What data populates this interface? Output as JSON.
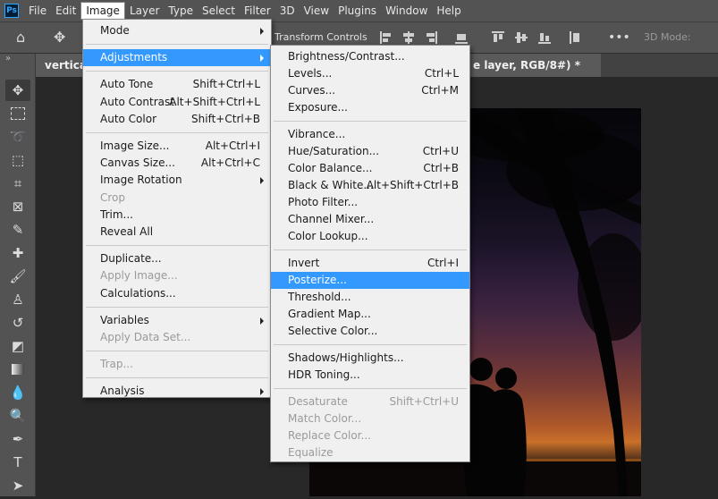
{
  "menubar": {
    "logo": "Ps",
    "items": [
      "File",
      "Edit",
      "Image",
      "Layer",
      "Type",
      "Select",
      "Filter",
      "3D",
      "View",
      "Plugins",
      "Window",
      "Help"
    ]
  },
  "options_bar": {
    "transform_controls": "Transform Controls",
    "mode_3d": "3D Mode:"
  },
  "tabs": {
    "doc1": "vertical",
    "doc2": "e layer, RGB/8#) *"
  },
  "image_menu": [
    {
      "label": "Mode",
      "arrow": true
    },
    {
      "sep": true
    },
    {
      "label": "Adjustments",
      "arrow": true,
      "highlighted": true
    },
    {
      "sep": true
    },
    {
      "label": "Auto Tone",
      "shortcut": "Shift+Ctrl+L"
    },
    {
      "label": "Auto Contrast",
      "shortcut": "Alt+Shift+Ctrl+L"
    },
    {
      "label": "Auto Color",
      "shortcut": "Shift+Ctrl+B"
    },
    {
      "sep": true
    },
    {
      "label": "Image Size...",
      "shortcut": "Alt+Ctrl+I"
    },
    {
      "label": "Canvas Size...",
      "shortcut": "Alt+Ctrl+C"
    },
    {
      "label": "Image Rotation",
      "arrow": true
    },
    {
      "label": "Crop",
      "disabled": true
    },
    {
      "label": "Trim..."
    },
    {
      "label": "Reveal All"
    },
    {
      "sep": true
    },
    {
      "label": "Duplicate..."
    },
    {
      "label": "Apply Image...",
      "disabled": true
    },
    {
      "label": "Calculations..."
    },
    {
      "sep": true
    },
    {
      "label": "Variables",
      "arrow": true
    },
    {
      "label": "Apply Data Set...",
      "disabled": true
    },
    {
      "sep": true
    },
    {
      "label": "Trap...",
      "disabled": true
    },
    {
      "sep": true
    },
    {
      "label": "Analysis",
      "arrow": true
    }
  ],
  "adjustments_menu": [
    {
      "label": "Brightness/Contrast..."
    },
    {
      "label": "Levels...",
      "shortcut": "Ctrl+L"
    },
    {
      "label": "Curves...",
      "shortcut": "Ctrl+M"
    },
    {
      "label": "Exposure..."
    },
    {
      "sep": true
    },
    {
      "label": "Vibrance..."
    },
    {
      "label": "Hue/Saturation...",
      "shortcut": "Ctrl+U"
    },
    {
      "label": "Color Balance...",
      "shortcut": "Ctrl+B"
    },
    {
      "label": "Black & White...",
      "shortcut": "Alt+Shift+Ctrl+B"
    },
    {
      "label": "Photo Filter..."
    },
    {
      "label": "Channel Mixer..."
    },
    {
      "label": "Color Lookup..."
    },
    {
      "sep": true
    },
    {
      "label": "Invert",
      "shortcut": "Ctrl+I"
    },
    {
      "label": "Posterize...",
      "highlighted": true
    },
    {
      "label": "Threshold..."
    },
    {
      "label": "Gradient Map..."
    },
    {
      "label": "Selective Color..."
    },
    {
      "sep": true
    },
    {
      "label": "Shadows/Highlights..."
    },
    {
      "label": "HDR Toning..."
    },
    {
      "sep": true
    },
    {
      "label": "Desaturate",
      "shortcut": "Shift+Ctrl+U",
      "disabled": true
    },
    {
      "label": "Match Color...",
      "disabled": true
    },
    {
      "label": "Replace Color...",
      "disabled": true
    },
    {
      "label": "Equalize",
      "disabled": true
    }
  ],
  "colors": {
    "highlight": "#3399ff",
    "menu_bg": "#f0f0f0",
    "chrome": "#535353"
  }
}
